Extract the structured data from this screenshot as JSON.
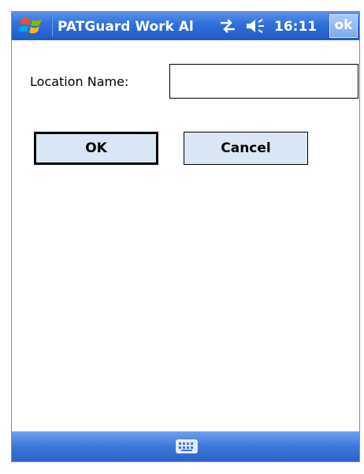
{
  "window": {
    "title": "PATGuard Work Al",
    "clock": "16:11",
    "ok_label": "ok",
    "start_icon": "windows-flag-icon",
    "status_icons": [
      "connectivity-icon",
      "volume-icon"
    ]
  },
  "form": {
    "location_label": "Location Name:",
    "location_value": "",
    "location_placeholder": ""
  },
  "buttons": {
    "ok_label": "OK",
    "cancel_label": "Cancel"
  },
  "menubar": {
    "icon": "keyboard-icon"
  },
  "colors": {
    "titlebar": "#2f6fd9",
    "menubar": "#3f78dc",
    "button_fill": "#dbe6f4"
  }
}
